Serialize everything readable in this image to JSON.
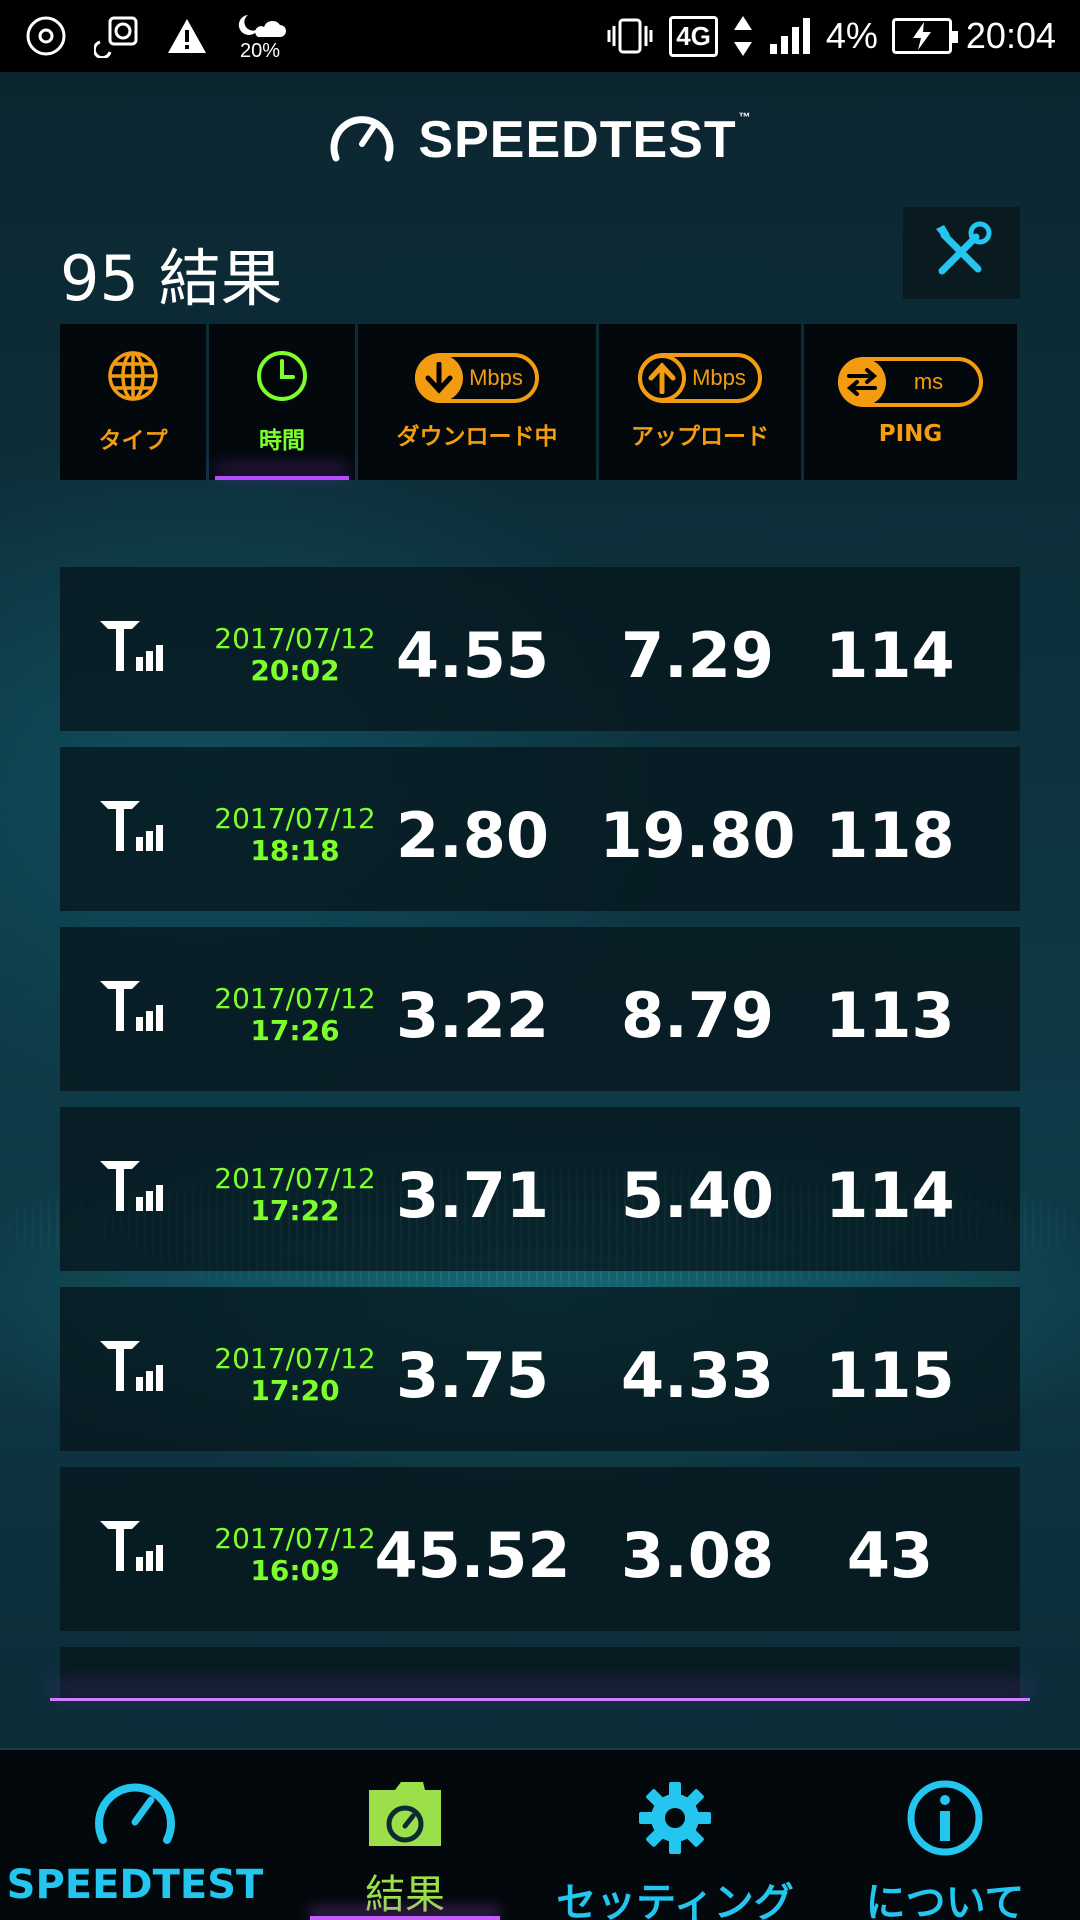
{
  "status_bar": {
    "weather_pct": "20%",
    "battery_pct": "4%",
    "time": "20:04",
    "network": "4G"
  },
  "header": {
    "logo": "SPEEDTEST",
    "trademark": "™",
    "results_count": "95 結果"
  },
  "sort_tabs": [
    {
      "label": "タイプ",
      "icon": "globe-icon"
    },
    {
      "label": "時間",
      "icon": "clock-icon",
      "active": true
    },
    {
      "label": "ダウンロード中",
      "icon": "download-arrow-icon",
      "unit": "Mbps"
    },
    {
      "label": "アップロード",
      "icon": "upload-arrow-icon",
      "unit": "Mbps"
    },
    {
      "label": "PING",
      "icon": "ping-arrows-icon",
      "unit": "ms"
    }
  ],
  "results": [
    {
      "date": "2017/07/12",
      "time": "20:02",
      "download": "4.55",
      "upload": "7.29",
      "ping": "114"
    },
    {
      "date": "2017/07/12",
      "time": "18:18",
      "download": "2.80",
      "upload": "19.80",
      "ping": "118"
    },
    {
      "date": "2017/07/12",
      "time": "17:26",
      "download": "3.22",
      "upload": "8.79",
      "ping": "113"
    },
    {
      "date": "2017/07/12",
      "time": "17:22",
      "download": "3.71",
      "upload": "5.40",
      "ping": "114"
    },
    {
      "date": "2017/07/12",
      "time": "17:20",
      "download": "3.75",
      "upload": "4.33",
      "ping": "115"
    },
    {
      "date": "2017/07/12",
      "time": "16:09",
      "download": "45.52",
      "upload": "3.08",
      "ping": "43"
    }
  ],
  "bottom_nav": [
    {
      "label": "SPEEDTEST",
      "icon": "speedometer-icon"
    },
    {
      "label": "結果",
      "icon": "results-folder-icon",
      "active": true
    },
    {
      "label": "セッティング",
      "icon": "gear-icon"
    },
    {
      "label": "について",
      "icon": "info-icon"
    }
  ],
  "colors": {
    "accent_orange": "#f39c12",
    "accent_green": "#7cff2b",
    "accent_cyan": "#24c6f0",
    "accent_purple": "#c45cff"
  }
}
